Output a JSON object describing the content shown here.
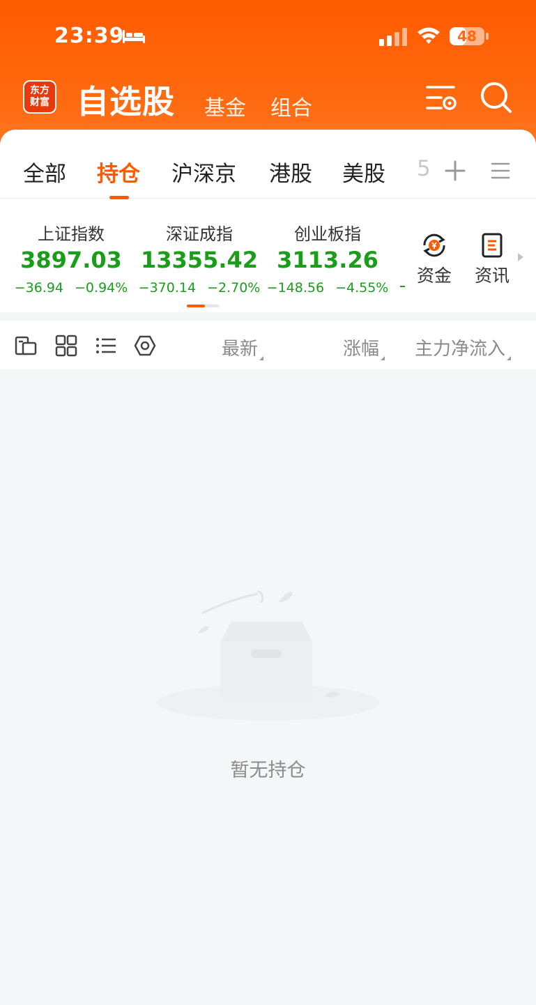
{
  "status_bar": {
    "time": "23:39",
    "battery": "48",
    "battery_level": 0.48,
    "icons": [
      "bed-icon",
      "signal-icon",
      "wifi-icon",
      "battery-icon"
    ]
  },
  "nav": {
    "logo_line1": "东方",
    "logo_line2": "财富",
    "title": "自选股",
    "fund": "基金",
    "portfolio": "组合",
    "icons": [
      "settings-list-icon",
      "search-icon"
    ]
  },
  "tabs": {
    "items": [
      "全部",
      "持仓",
      "沪深京",
      "港股",
      "美股"
    ],
    "active": "持仓",
    "overflow": "5",
    "icons": [
      "plus-icon",
      "menu-icon"
    ]
  },
  "indices": [
    {
      "name": "上证指数",
      "value": "3897.03",
      "change": "−36.94",
      "pct": "−0.94%"
    },
    {
      "name": "深证成指",
      "value": "13355.42",
      "change": "−370.14",
      "pct": "−2.70%"
    },
    {
      "name": "创业板指",
      "value": "3113.26",
      "change": "−148.56",
      "pct": "−4.55%"
    }
  ],
  "quick_links": [
    {
      "label": "资金",
      "icon": "yuan-exchange-icon"
    },
    {
      "label": "资讯",
      "icon": "news-doc-icon"
    }
  ],
  "toolbar": {
    "icons": [
      "layout-icon",
      "grid-icon",
      "list-icon",
      "hexagon-settings-icon"
    ],
    "col_latest": "最新",
    "col_change": "涨幅",
    "col_flow": "主力净流入"
  },
  "empty_state": {
    "text": "暂无持仓"
  },
  "colors": {
    "brand_orange": "#ff5a00",
    "down_green": "#1a9e1a",
    "background": "#f5f6f8"
  }
}
